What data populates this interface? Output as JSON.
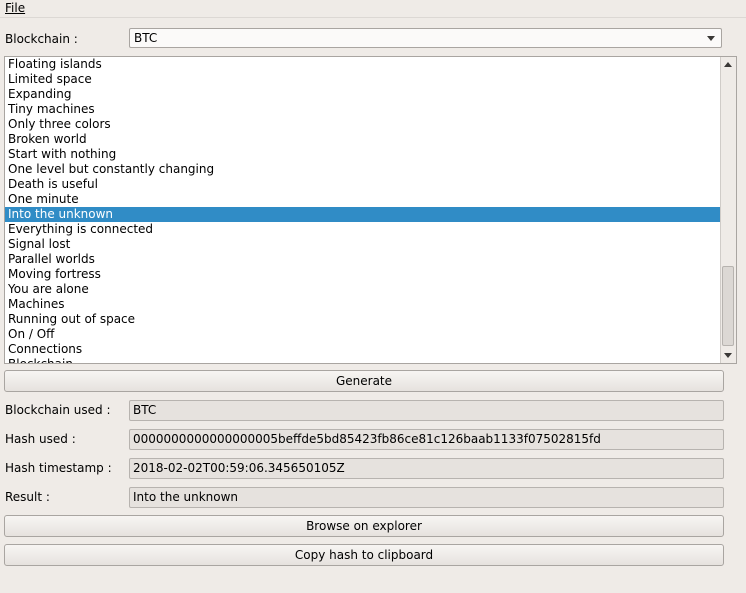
{
  "menu": {
    "file_label": "File"
  },
  "blockchain": {
    "label": "Blockchain :",
    "selected": "BTC"
  },
  "list": {
    "items": [
      "Floating islands",
      "Limited space",
      "Expanding",
      "Tiny machines",
      "Only three colors",
      "Broken world",
      "Start with nothing",
      "One level but constantly changing",
      "Death is useful",
      "One minute",
      "Into the unknown",
      "Everything is connected",
      "Signal lost",
      "Parallel worlds",
      "Moving fortress",
      "You are alone",
      "Machines",
      "Running out of space",
      "On / Off",
      "Connections",
      "Blockchain"
    ],
    "selected_index": 10
  },
  "buttons": {
    "generate": "Generate",
    "browse": "Browse on explorer",
    "copy": "Copy hash to clipboard"
  },
  "results": {
    "blockchain_used_label": "Blockchain used :",
    "blockchain_used_value": "BTC",
    "hash_used_label": "Hash used :",
    "hash_used_value": "0000000000000000005beffde5bd85423fb86ce81c126baab1133f07502815fd",
    "hash_timestamp_label": "Hash timestamp :",
    "hash_timestamp_value": "2018-02-02T00:59:06.345650105Z",
    "result_label": "Result :",
    "result_value": "Into the unknown"
  },
  "colors": {
    "selection": "#308cc6",
    "window_bg": "#efebe7"
  }
}
